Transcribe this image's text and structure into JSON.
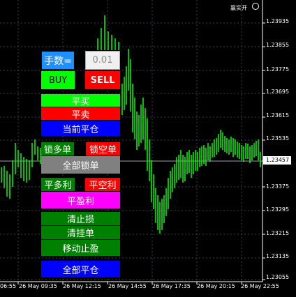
{
  "colors": {
    "background": "#000000",
    "grid": "#3a3f52",
    "candle": "#00ff00",
    "blue": "#1e90ff",
    "green": "#00ff00",
    "red": "#ff0000",
    "royal": "#0000ff",
    "gray": "#808080",
    "magenta": "#ff00ff",
    "dark_green": "#008000"
  },
  "brand": {
    "text": "赢实开"
  },
  "panel": {
    "lots_label": "手数=",
    "lots_value": "0.01",
    "buy": "BUY",
    "sell": "SELL",
    "close_buy": "平买",
    "close_sell": "平卖",
    "close_current": "当前平仓",
    "lock_long": "锁多单",
    "lock_short": "锁空单",
    "lock_all": "全部锁单",
    "close_long_profit": "平多利",
    "close_short_profit": "平空利",
    "close_profit": "平盈利",
    "clear_stop": "清止损",
    "clear_pending": "清挂单",
    "trailing_stop": "移动止盈",
    "close_all": "全部平仓"
  },
  "price_axis": {
    "labels": [
      "1.23935",
      "1.23855",
      "1.23775",
      "1.23695",
      "1.23615",
      "1.23535",
      "1.23457",
      "1.23375",
      "1.23295",
      "1.23215",
      "1.23135",
      "1.23055"
    ],
    "current_price": "1.23457"
  },
  "time_axis": {
    "labels": [
      "06:55",
      "26 May 09:35",
      "26 May 12:15",
      "26 May 14:55",
      "26 May 17:35",
      "26 May 20:15",
      "26 May 22:55"
    ]
  }
}
